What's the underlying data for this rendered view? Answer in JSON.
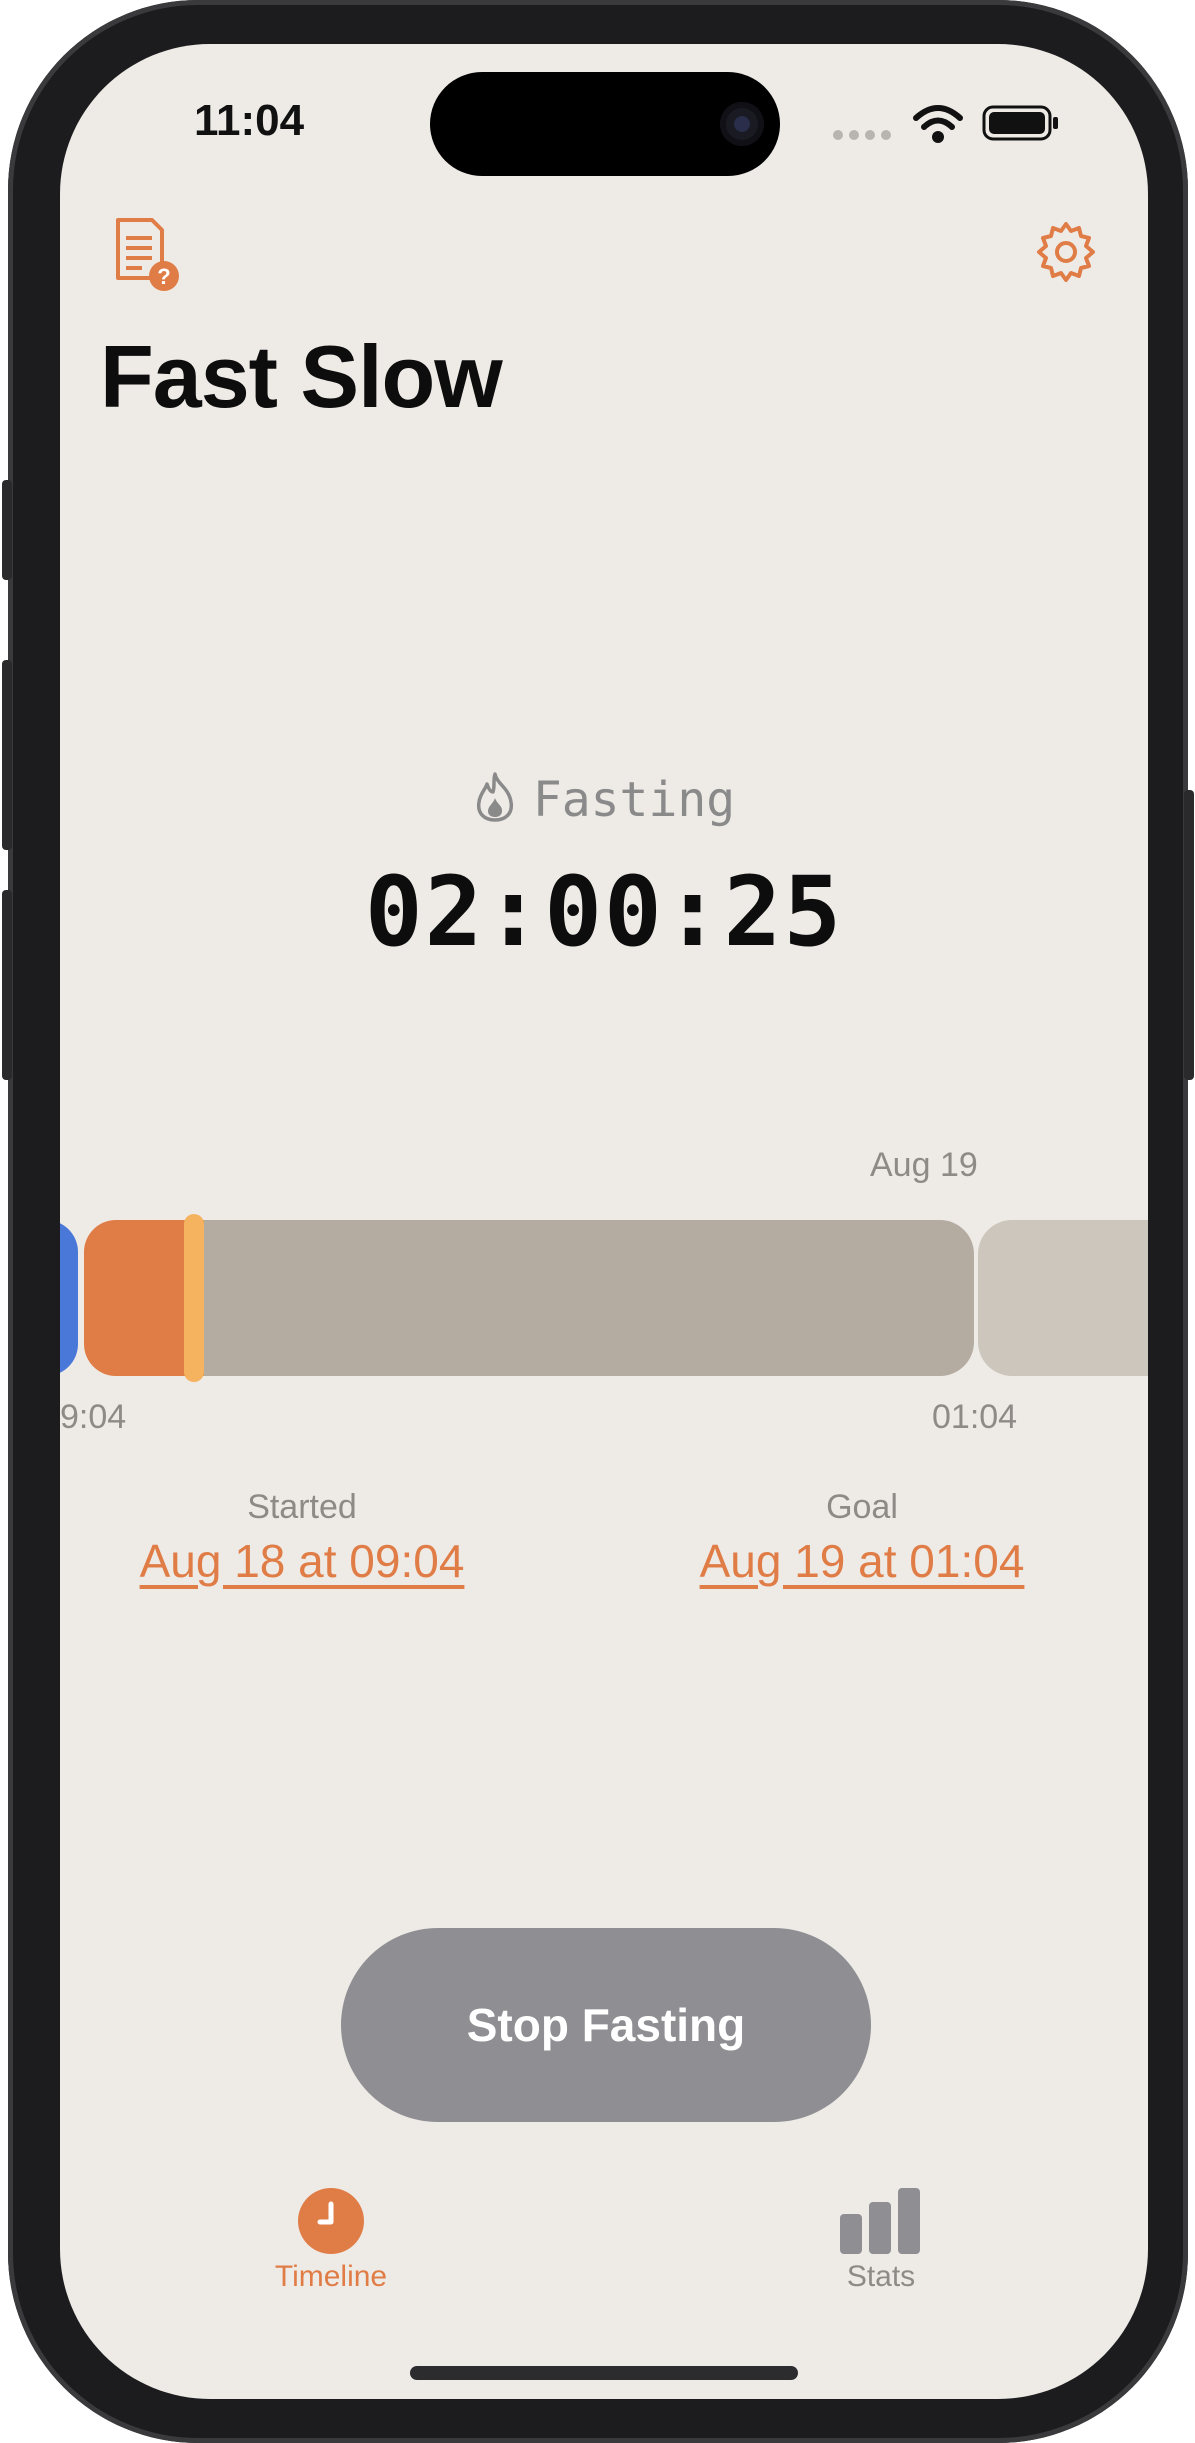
{
  "status_bar": {
    "time": "11:04"
  },
  "header": {
    "title": "Fast Slow",
    "left_icon": "document-question-icon",
    "right_icon": "gear-icon"
  },
  "fasting": {
    "state_label": "Fasting",
    "state_icon": "flame-icon",
    "elapsed": "02:00:25"
  },
  "timeline": {
    "date_label": "Aug 19",
    "start_tick": "9:04",
    "end_tick": "01:04"
  },
  "started": {
    "label": "Started",
    "value": "Aug 18 at 09:04"
  },
  "goal": {
    "label": "Goal",
    "value": "Aug 19 at 01:04"
  },
  "action": {
    "stop_label": "Stop Fasting"
  },
  "tabbar": {
    "tabs": [
      {
        "label": "Timeline",
        "icon": "clock-icon",
        "active": true
      },
      {
        "label": "Stats",
        "icon": "bar-chart-icon",
        "active": false
      }
    ]
  },
  "colors": {
    "accent": "#e07d47",
    "eating": "#4a78d8",
    "progress_marker": "#f5b35f",
    "fast_remaining": "#b5aca1",
    "next_block": "#cdc6bd",
    "button_gray": "#8f8f93",
    "background": "#eeebe7"
  }
}
